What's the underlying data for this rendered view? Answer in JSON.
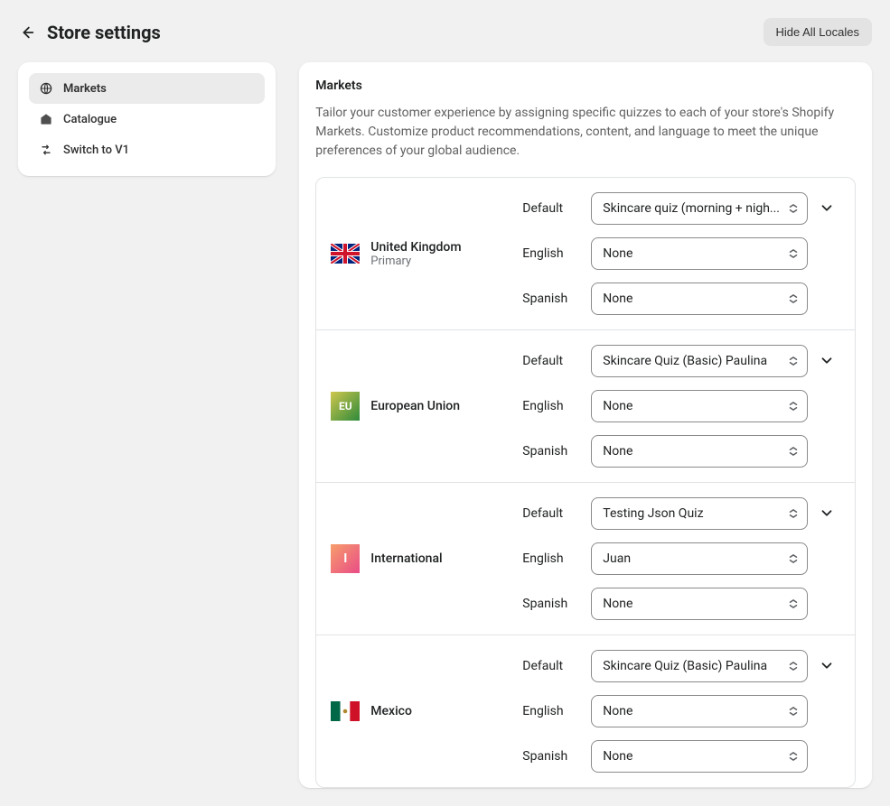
{
  "header": {
    "title": "Store settings",
    "hide_locales": "Hide All Locales"
  },
  "sidebar": {
    "items": [
      {
        "label": "Markets"
      },
      {
        "label": "Catalogue"
      },
      {
        "label": "Switch to V1"
      }
    ]
  },
  "section": {
    "title": "Markets",
    "description": "Tailor your customer experience by assigning specific quizzes to each of your store's Shopify Markets. Customize product recommendations, content, and language to meet the unique preferences of your global audience."
  },
  "locale_labels": {
    "default": "Default",
    "english": "English",
    "spanish": "Spanish"
  },
  "markets": [
    {
      "name": "United Kingdom",
      "subname": "Primary",
      "flag_badge": "",
      "default_quiz": "Skincare quiz (morning + nigh...",
      "english_quiz": "None",
      "spanish_quiz": "None"
    },
    {
      "name": "European Union",
      "subname": "",
      "flag_badge": "EU",
      "default_quiz": "Skincare Quiz (Basic) Paulina",
      "english_quiz": "None",
      "spanish_quiz": "None"
    },
    {
      "name": "International",
      "subname": "",
      "flag_badge": "I",
      "default_quiz": "Testing Json Quiz",
      "english_quiz": "Juan",
      "spanish_quiz": "None"
    },
    {
      "name": "Mexico",
      "subname": "",
      "flag_badge": "",
      "default_quiz": "Skincare Quiz (Basic) Paulina",
      "english_quiz": "None",
      "spanish_quiz": "None"
    }
  ]
}
